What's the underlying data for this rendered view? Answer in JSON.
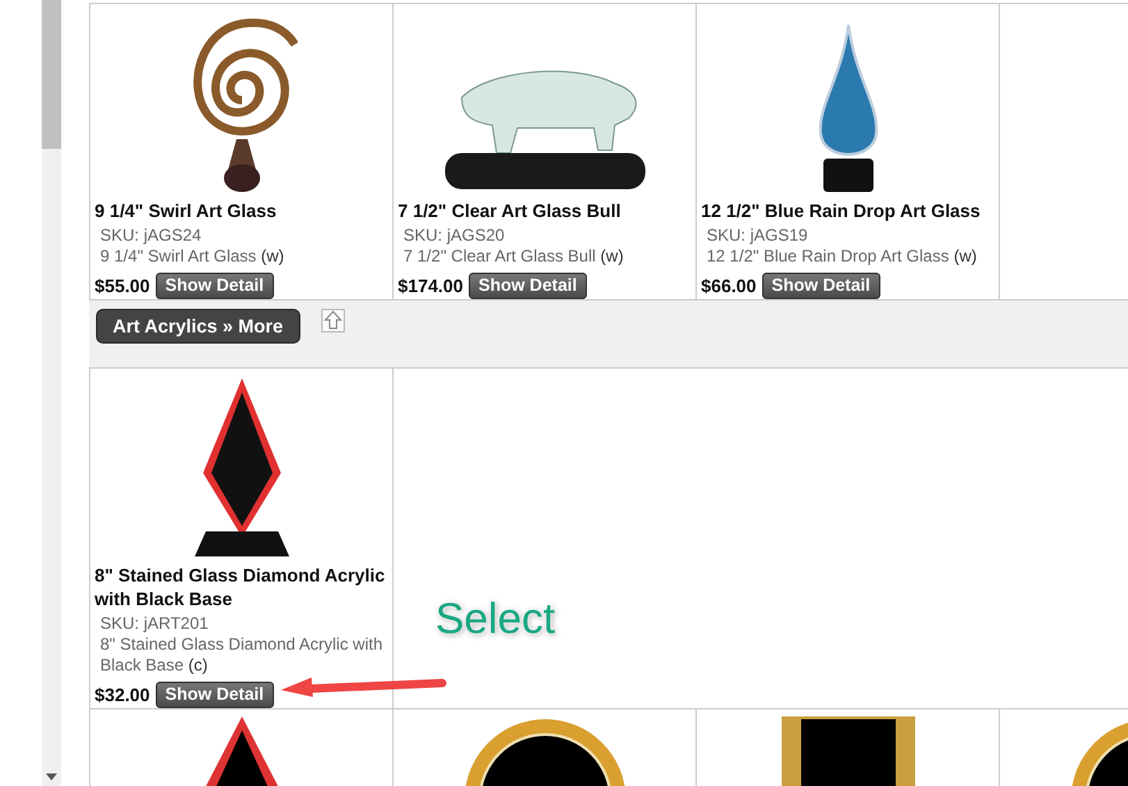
{
  "top_row": [
    {
      "kind": "swirl",
      "name": "9 1/4\" Swirl Art Glass",
      "sku": "SKU: jAGS24",
      "description": "9 1/4\" Swirl Art Glass",
      "code": "(w)",
      "price": "$55.00",
      "button": "Show Detail"
    },
    {
      "kind": "bull",
      "name": "7 1/2\" Clear Art Glass Bull",
      "sku": "SKU: jAGS20",
      "description": "7 1/2\" Clear Art Glass Bull",
      "code": "(w)",
      "price": "$174.00",
      "button": "Show Detail"
    },
    {
      "kind": "drop",
      "name": "12 1/2\" Blue Rain Drop Art Glass",
      "sku": "SKU: jAGS19",
      "description": "12 1/2\" Blue Rain Drop Art Glass",
      "code": "(w)",
      "price": "$66.00",
      "button": "Show Detail"
    }
  ],
  "category": {
    "label": "Art Acrylics » More"
  },
  "second_row": [
    {
      "kind": "diamond",
      "name": "8\" Stained Glass Diamond Acrylic with Black Base",
      "sku": "SKU: jART201",
      "description": "8\" Stained Glass Diamond Acrylic with Black Base",
      "code": "(c)",
      "price": "$32.00",
      "button": "Show Detail"
    }
  ],
  "third_row": [
    {
      "kind": "triangle"
    },
    {
      "kind": "circle"
    },
    {
      "kind": "rectangle"
    },
    {
      "kind": "circle"
    }
  ],
  "annotation": {
    "text": "Select"
  }
}
